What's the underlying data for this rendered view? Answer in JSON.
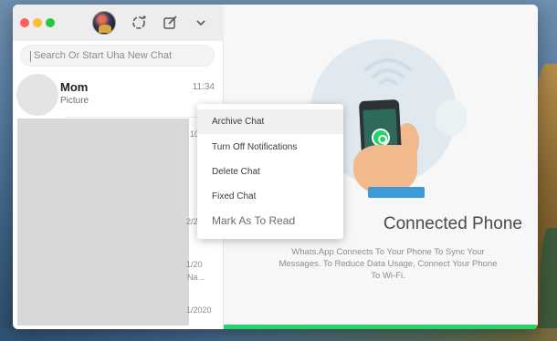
{
  "window": {
    "title": ""
  },
  "toolbar": {
    "avatar_icon": "profile-avatar",
    "status_icon": "status-ring-icon",
    "compose_icon": "compose-icon",
    "menu_icon": "chevron-down-icon"
  },
  "search": {
    "placeholder": "Search Or Start Uha New Chat"
  },
  "chats": [
    {
      "name": "Mom",
      "subtitle": "Picture",
      "time": "11:34"
    }
  ],
  "partial_labels": {
    "l1": "10",
    "l2": "2/2",
    "l3": "1/20",
    "l4": "Na ..",
    "l5": "1/2020"
  },
  "context_menu": {
    "items": [
      "Archive Chat",
      "Turn Off Notifications",
      "Delete Chat",
      "Fixed Chat",
      "Mark As To Read"
    ],
    "highlighted_index": 0
  },
  "main": {
    "title": "Connected Phone",
    "description": "Whats.App Connects To Your Phone To Sync Your Messages. To Reduce Data Usage, Connect Your Phone To Wi-Fi."
  },
  "colors": {
    "accent": "#25d366",
    "titlebar": "#ededed",
    "panel": "#f7f7f7"
  }
}
